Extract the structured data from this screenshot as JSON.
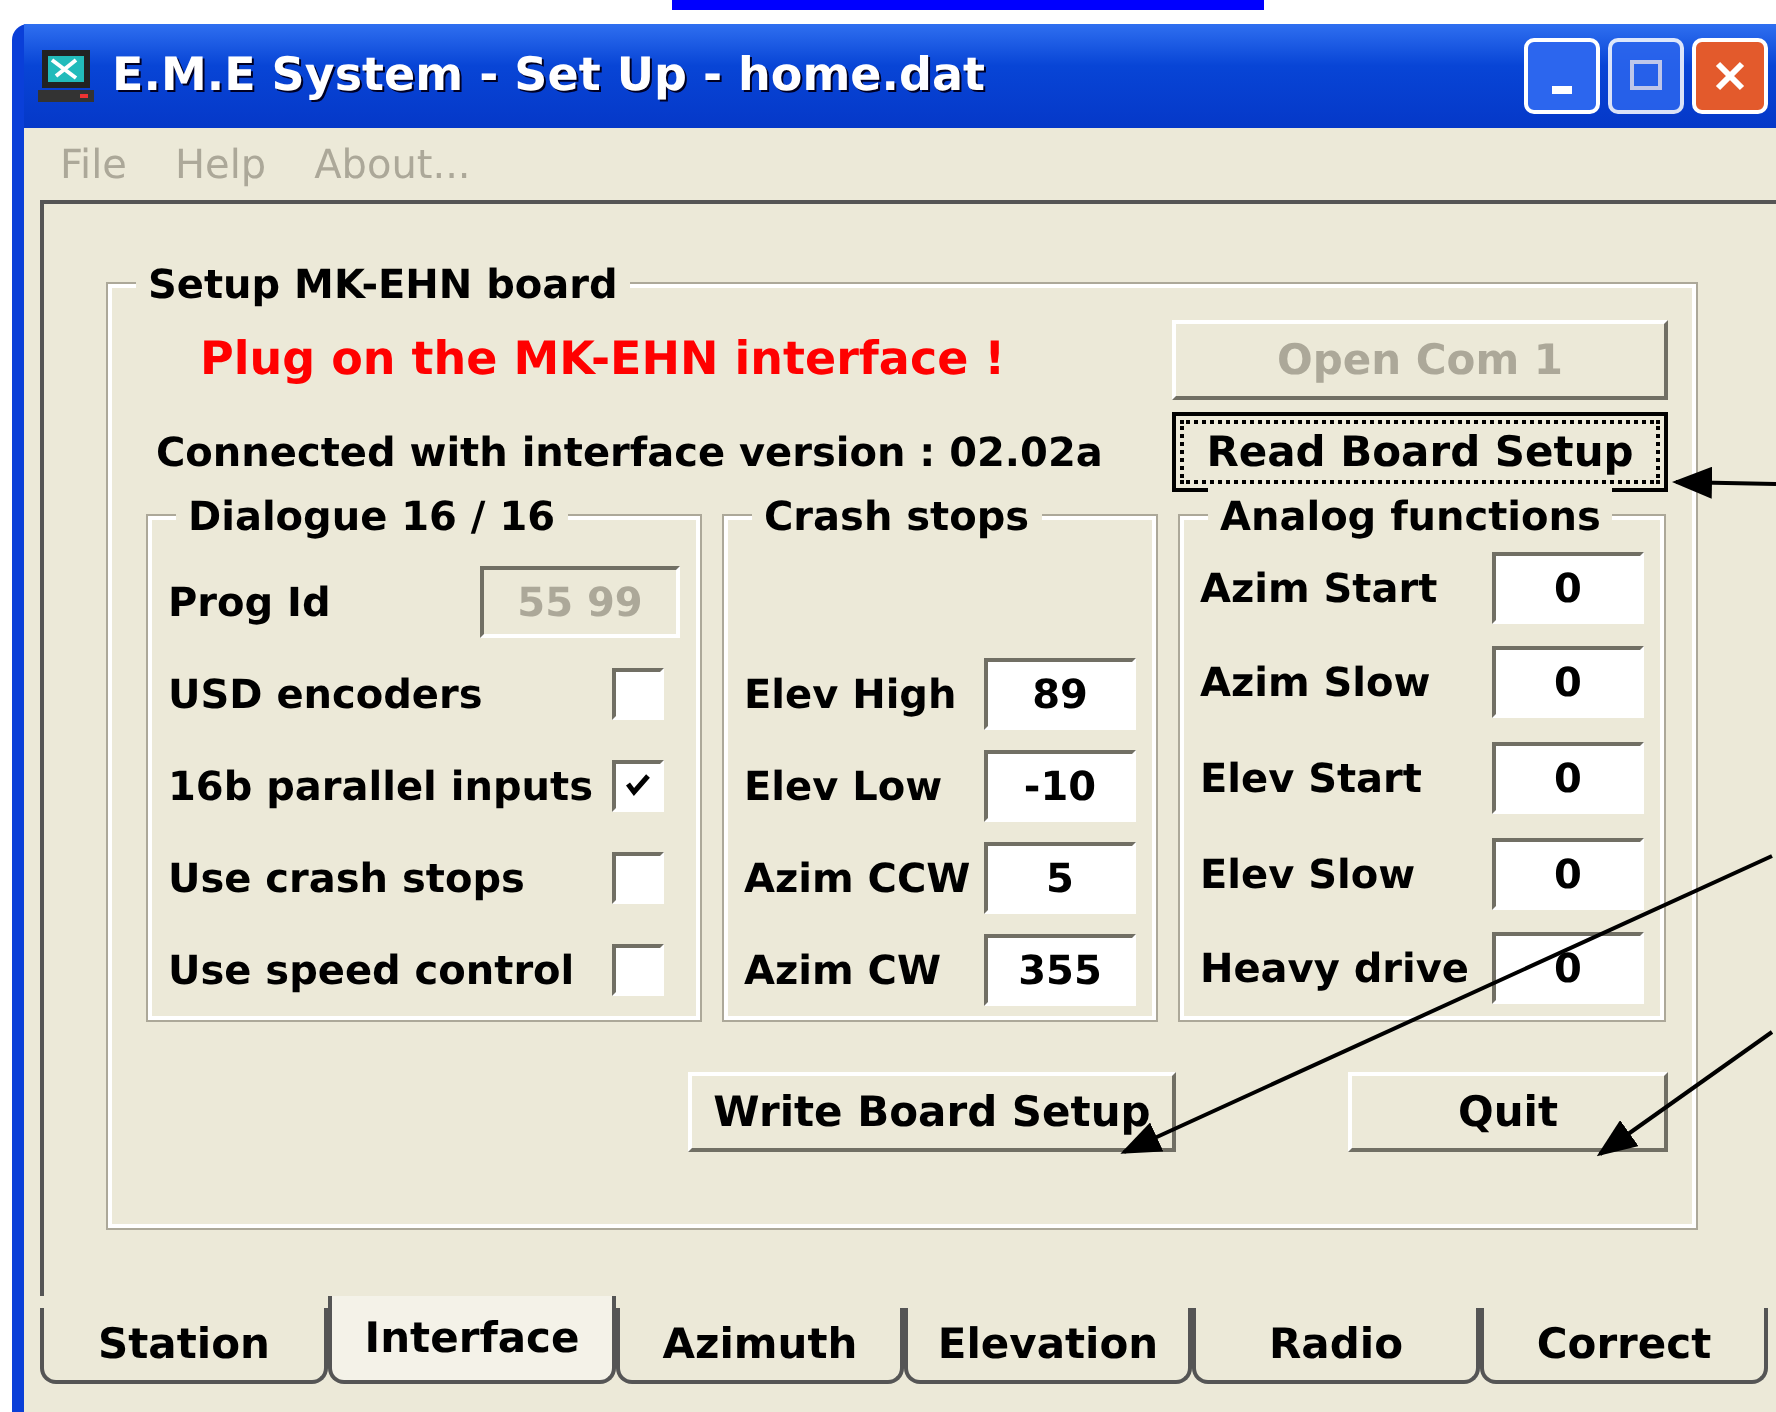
{
  "window": {
    "title": "E.M.E System - Set Up - home.dat"
  },
  "menu": [
    {
      "label": "File",
      "disabled": true
    },
    {
      "label": "Help",
      "disabled": true
    },
    {
      "label": "About...",
      "disabled": true
    }
  ],
  "setup": {
    "title": "Setup MK-EHN board",
    "warning": "Plug on the MK-EHN interface !",
    "status": "Connected with interface version : 02.02a",
    "open_button": {
      "label": "Open Com 1",
      "disabled": true
    },
    "read_button": {
      "label": "Read Board Setup",
      "focused": true
    },
    "dialogue": {
      "title": "Dialogue 16 / 16",
      "prog_id": {
        "label": "Prog Id",
        "value": "55 99",
        "disabled": true
      },
      "options": [
        {
          "label": "USD encoders",
          "checked": false
        },
        {
          "label": "16b parallel inputs",
          "checked": true
        },
        {
          "label": "Use crash stops",
          "checked": false
        },
        {
          "label": "Use speed control",
          "checked": false
        }
      ]
    },
    "crash_stops": {
      "title": "Crash stops",
      "fields": [
        {
          "label": "Elev High",
          "value": "89"
        },
        {
          "label": "Elev Low",
          "value": "-10"
        },
        {
          "label": "Azim CCW",
          "value": "5"
        },
        {
          "label": "Azim CW",
          "value": "355"
        }
      ]
    },
    "analog": {
      "title": "Analog functions",
      "fields": [
        {
          "label": "Azim Start",
          "value": "0"
        },
        {
          "label": "Azim Slow",
          "value": "0"
        },
        {
          "label": "Elev Start",
          "value": "0"
        },
        {
          "label": "Elev Slow",
          "value": "0"
        },
        {
          "label": "Heavy drive",
          "value": "0"
        }
      ]
    },
    "write_button": {
      "label": "Write Board Setup"
    },
    "quit_button": {
      "label": "Quit"
    }
  },
  "tabs": [
    {
      "label": "Station",
      "selected": false
    },
    {
      "label": "Interface",
      "selected": true
    },
    {
      "label": "Azimuth",
      "selected": false
    },
    {
      "label": "Elevation",
      "selected": false
    },
    {
      "label": "Radio",
      "selected": false
    },
    {
      "label": "Correct",
      "selected": false
    }
  ]
}
